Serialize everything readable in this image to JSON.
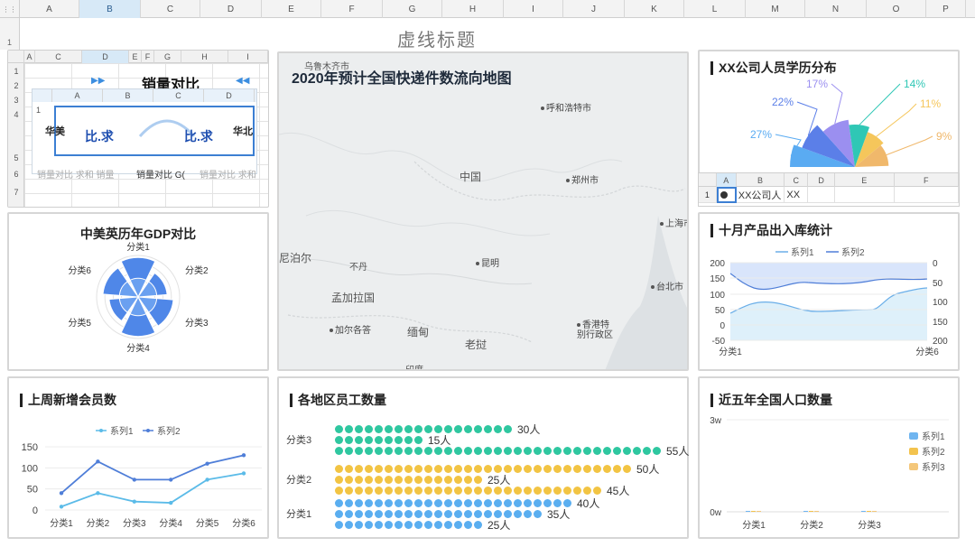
{
  "sheet": {
    "corner_icon": "grid-icon",
    "columns": [
      "A",
      "B",
      "C",
      "D",
      "E",
      "F",
      "G",
      "H",
      "I",
      "J",
      "K",
      "L",
      "M",
      "N",
      "O",
      "P"
    ],
    "selected_column": "B",
    "row_label": "1"
  },
  "dashboard_title": "虚线标题",
  "sales_sheet": {
    "columns": [
      "A",
      "C",
      "D",
      "E",
      "F",
      "G",
      "H",
      "I"
    ],
    "rows": [
      "1",
      "2",
      "3",
      "4",
      "5",
      "6",
      "7"
    ],
    "title": "销量对比",
    "inner_columns": [
      "A",
      "B",
      "C",
      "D"
    ],
    "inner_row": "1",
    "cell_big_1": "比.求",
    "cell_big_2": "比.求",
    "left_label": "华美",
    "right_label": "华北",
    "row6_left": "销量对比 求和 销量",
    "row6_mid": "销量对比 G(",
    "row6_right": "销量对比 求和"
  },
  "radar": {
    "title": "中美英历年GDP对比",
    "labels": [
      "分类1",
      "分类2",
      "分类3",
      "分类4",
      "分类5",
      "分类6"
    ]
  },
  "map": {
    "title": "2020年预计全国快递件数流向地图",
    "places": [
      {
        "name": "乌鲁木齐市"
      },
      {
        "name": "呼和浩特市"
      },
      {
        "name": "中国"
      },
      {
        "name": "郑州市"
      },
      {
        "name": "上海市"
      },
      {
        "name": "尼泊尔"
      },
      {
        "name": "不丹"
      },
      {
        "name": "昆明"
      },
      {
        "name": "孟加拉国"
      },
      {
        "name": "台北市"
      },
      {
        "name": "加尔各答"
      },
      {
        "name": "缅甸"
      },
      {
        "name": "香港特别行政区"
      },
      {
        "name": "老挝"
      },
      {
        "name": "印度"
      }
    ]
  },
  "education": {
    "title": "XX公司人员学历分布",
    "slices": [
      {
        "label": "27%",
        "value": 27,
        "color": "#5aabf2"
      },
      {
        "label": "22%",
        "value": 22,
        "color": "#5b7fe8"
      },
      {
        "label": "17%",
        "value": 17,
        "color": "#9b8ff0"
      },
      {
        "label": "14%",
        "value": 14,
        "color": "#2fc7b5"
      },
      {
        "label": "11%",
        "value": 11,
        "color": "#f5c65b"
      },
      {
        "label": "9%",
        "value": 9,
        "color": "#f0b86b"
      }
    ],
    "sheet_columns": [
      "A",
      "B",
      "C",
      "D",
      "E",
      "F"
    ],
    "sheet_row": "1",
    "cell_b1": "XX公司人",
    "cell_c1": "XX"
  },
  "stock": {
    "title": "十月产品出入库统计",
    "legend": [
      "系列1",
      "系列2"
    ],
    "left_ticks": [
      "200",
      "150",
      "100",
      "50",
      "0",
      "-50"
    ],
    "right_ticks": [
      "0",
      "50",
      "100",
      "150",
      "200"
    ],
    "x_labels": [
      "分类1",
      "分类6"
    ]
  },
  "members": {
    "title": "上周新增会员数",
    "legend": [
      "系列1",
      "系列2"
    ],
    "y_ticks": [
      "150",
      "100",
      "50",
      "0"
    ],
    "chart_data": {
      "type": "line",
      "categories": [
        "分类1",
        "分类2",
        "分类3",
        "分类4",
        "分类5",
        "分类6"
      ],
      "series": [
        {
          "name": "系列1",
          "values": [
            8,
            40,
            20,
            17,
            72,
            87
          ],
          "color": "#5bbbe8"
        },
        {
          "name": "系列2",
          "values": [
            40,
            115,
            72,
            72,
            110,
            130
          ],
          "color": "#4f7ed8"
        }
      ],
      "ylim": [
        0,
        150
      ]
    }
  },
  "staff": {
    "title": "各地区员工数量",
    "chart_data": {
      "type": "bar",
      "categories": [
        "分类3",
        "分类2",
        "分类1"
      ],
      "series": [
        {
          "category": "分类3",
          "bars": [
            {
              "value": 30,
              "label": "30人",
              "color": "#2fc7a0"
            },
            {
              "value": 15,
              "label": "15人",
              "color": "#2fc7a0"
            },
            {
              "value": 55,
              "label": "55人",
              "color": "#2fc7a0"
            }
          ]
        },
        {
          "category": "分类2",
          "bars": [
            {
              "value": 50,
              "label": "50人",
              "color": "#f2c443"
            },
            {
              "value": 25,
              "label": "25人",
              "color": "#f2c443"
            },
            {
              "value": 45,
              "label": "45人",
              "color": "#f2c443"
            }
          ]
        },
        {
          "category": "分类1",
          "bars": [
            {
              "value": 40,
              "label": "40人",
              "color": "#5aaef0"
            },
            {
              "value": 35,
              "label": "35人",
              "color": "#5aaef0"
            },
            {
              "value": 25,
              "label": "25人",
              "color": "#5aaef0"
            }
          ]
        }
      ]
    }
  },
  "population": {
    "title": "近五年全国人口数量",
    "y_ticks": [
      "3w",
      "0w"
    ],
    "x_labels": [
      "分类1",
      "分类2",
      "分类3"
    ],
    "legend": [
      {
        "name": "系列1",
        "color": "#6fb5f0"
      },
      {
        "name": "系列2",
        "color": "#f3c34e"
      },
      {
        "name": "系列3",
        "color": "#f4c77a"
      }
    ]
  }
}
